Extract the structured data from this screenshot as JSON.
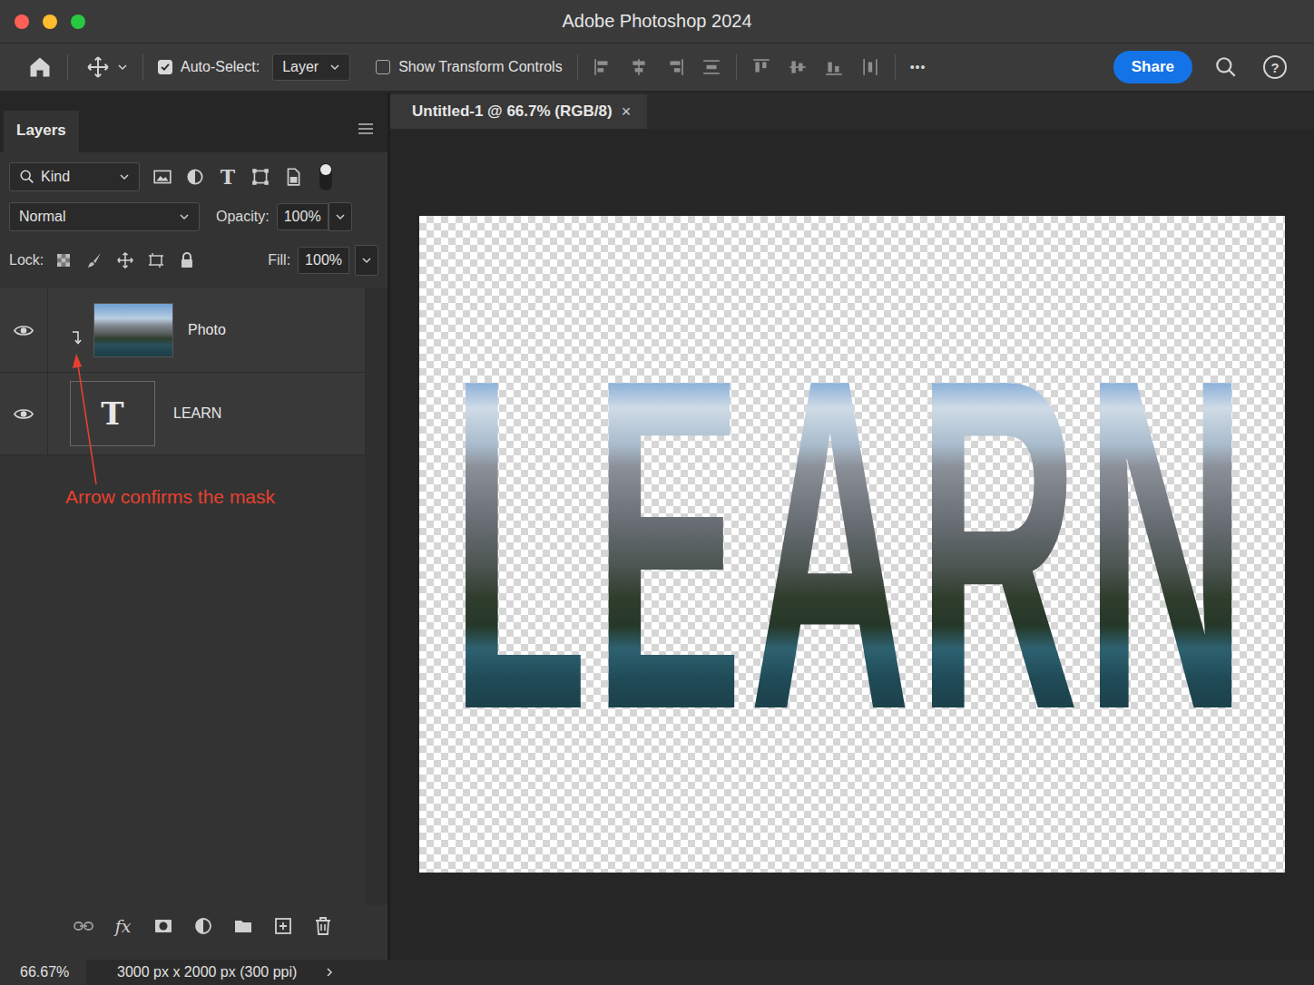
{
  "window": {
    "title": "Adobe Photoshop 2024"
  },
  "options_bar": {
    "auto_select": {
      "label": "Auto-Select:",
      "checked": true
    },
    "target": {
      "value": "Layer"
    },
    "transform_controls": {
      "label": "Show Transform Controls",
      "checked": false
    },
    "more": "•••",
    "share": "Share",
    "help": "?"
  },
  "layers_panel": {
    "tab": "Layers",
    "filter": {
      "value": "Kind",
      "type_glyph": "T",
      "enabled": true
    },
    "blend_mode": "Normal",
    "opacity": {
      "label": "Opacity:",
      "value": "100%"
    },
    "lock": {
      "label": "Lock:"
    },
    "fill": {
      "label": "Fill:",
      "value": "100%"
    },
    "layers": [
      {
        "name": "Photo",
        "kind": "image",
        "visible": true,
        "clipped": true
      },
      {
        "name": "LEARN",
        "kind": "text",
        "visible": true,
        "clipped": false,
        "glyph": "T"
      }
    ],
    "annotation": "Arrow confirms the mask",
    "footer": {
      "fx": "fx"
    }
  },
  "document": {
    "tab": "Untitled-1 @ 66.7% (RGB/8)",
    "close": "×",
    "canvas_text": "LEARN"
  },
  "status_bar": {
    "zoom": "66.67%",
    "size": "3000 px x 2000 px (300 ppi)"
  }
}
